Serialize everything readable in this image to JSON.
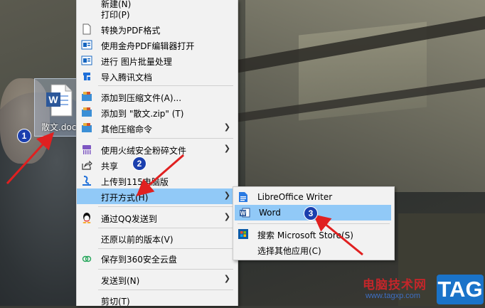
{
  "desktop_icon": {
    "label": "散文.docx",
    "icon": "word-document-icon"
  },
  "context_menu": {
    "items": [
      {
        "label": "新建(N)",
        "icon": ""
      },
      {
        "label": "打印(P)",
        "icon": ""
      },
      {
        "label": "转换为PDF格式",
        "icon": "pdf-document-icon"
      },
      {
        "label": "使用金舟PDF编辑器打开",
        "icon": "pdf-editor-icon"
      },
      {
        "label": "进行 图片批量处理",
        "icon": "image-batch-icon"
      },
      {
        "label": "导入腾讯文档",
        "icon": "tencent-docs-icon"
      },
      {
        "label": "添加到压缩文件(A)...",
        "icon": "archive-icon"
      },
      {
        "label": "添加到 \"散文.zip\" (T)",
        "icon": "archive-icon"
      },
      {
        "label": "其他压缩命令",
        "icon": "archive-icon"
      },
      {
        "label": "使用火绒安全粉碎文件",
        "icon": "shredder-icon"
      },
      {
        "label": "共享",
        "icon": "share-icon"
      },
      {
        "label": "上传到115电脑版",
        "icon": "upload-cloud-icon"
      },
      {
        "label": "打开方式(H)",
        "icon": ""
      },
      {
        "label": "通过QQ发送到",
        "icon": "qq-penguin-icon"
      },
      {
        "label": "还原以前的版本(V)",
        "icon": ""
      },
      {
        "label": "保存到360安全云盘",
        "icon": "360-cloud-icon"
      },
      {
        "label": "发送到(N)",
        "icon": ""
      },
      {
        "label": "剪切(T)",
        "icon": ""
      }
    ],
    "highlighted": "打开方式(H)"
  },
  "open_with_submenu": {
    "items": [
      {
        "label": "LibreOffice Writer",
        "icon": "libreoffice-writer-icon"
      },
      {
        "label": "Word",
        "icon": "word-icon"
      },
      {
        "label": "搜索 Microsoft Store(S)",
        "icon": "microsoft-store-icon"
      },
      {
        "label": "选择其他应用(C)",
        "icon": ""
      }
    ],
    "highlighted": "Word"
  },
  "annotations": {
    "badges": [
      "1",
      "2",
      "3"
    ],
    "arrow_color": "#e02020",
    "badge_color": "#1b3fae"
  },
  "watermark": {
    "text": "电脑技术网",
    "url": "www.tagxp.com",
    "tag": "TAG"
  },
  "colors": {
    "menu_bg": "#f2f2f2",
    "highlight": "#91c9f7"
  }
}
